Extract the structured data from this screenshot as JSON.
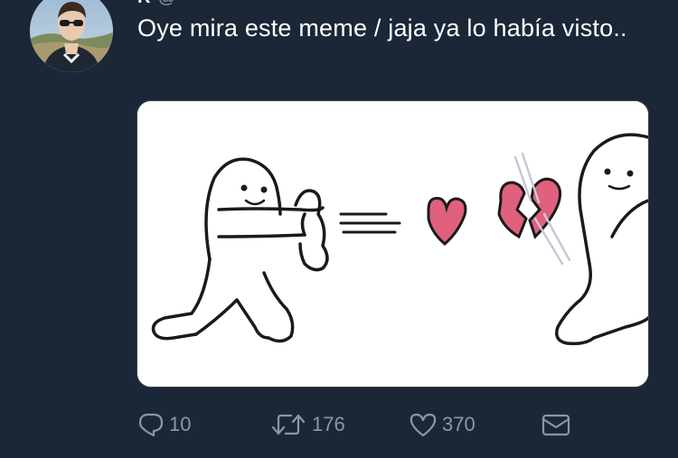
{
  "tweet": {
    "author_name": "R",
    "author_handle": "@",
    "text": "Oye mira este meme / jaja ya lo había visto..",
    "media_alt": "meme-image"
  },
  "actions": {
    "replies": "10",
    "retweets": "176",
    "likes": "370"
  },
  "icons": {
    "reply": "reply-icon",
    "retweet": "retweet-icon",
    "like": "heart-icon",
    "dm": "mail-icon"
  },
  "colors": {
    "background": "#1b2737",
    "text": "#ffffff",
    "muted": "#8899a6",
    "heart": "#e0607e"
  }
}
